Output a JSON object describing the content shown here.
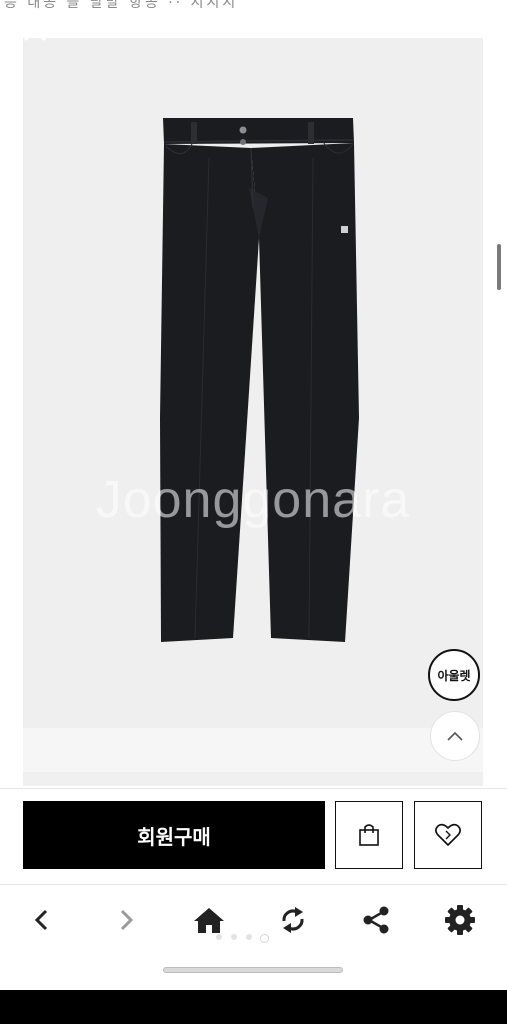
{
  "top_strip": {
    "text": "등 대공 들 달말 항공 ·· 시시시"
  },
  "viewer": {
    "close_icon": "close-icon",
    "watermark": "Joonggonara",
    "outlet_badge_label": "아울렛",
    "scroll_top_icon": "chevron-up-icon"
  },
  "purchase": {
    "buy_label": "회원구매",
    "cart_icon": "shopping-bag-icon",
    "wish_icon": "heart-icon"
  },
  "bottom_nav": {
    "items": [
      {
        "icon": "chevron-left-icon",
        "name": "back"
      },
      {
        "icon": "chevron-right-icon",
        "name": "forward"
      },
      {
        "icon": "home-icon",
        "name": "home"
      },
      {
        "icon": "refresh-icon",
        "name": "refresh"
      },
      {
        "icon": "share-icon",
        "name": "share"
      },
      {
        "icon": "gear-icon",
        "name": "settings"
      }
    ],
    "page_dots": {
      "count": 4,
      "active_index": 3
    }
  },
  "colors": {
    "primary": "#000000",
    "icon_dark": "#222222",
    "icon_disabled": "#9a9a9a",
    "image_bg": "#efefef"
  }
}
